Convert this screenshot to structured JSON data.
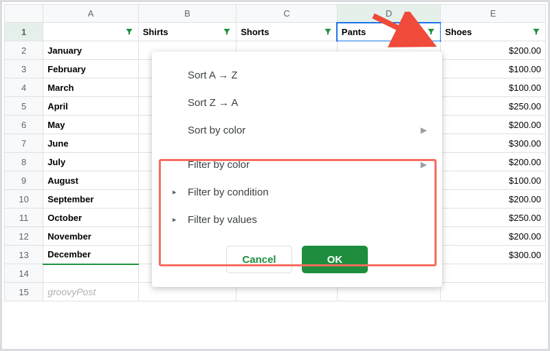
{
  "columns": {
    "A": "A",
    "B": "B",
    "C": "C",
    "D": "D",
    "E": "E"
  },
  "headers": {
    "B": "Shirts",
    "C": "Shorts",
    "D": "Pants",
    "E": "Shoes"
  },
  "months": [
    "January",
    "February",
    "March",
    "April",
    "May",
    "June",
    "July",
    "August",
    "September",
    "October",
    "November",
    "December"
  ],
  "values_E": [
    "$200.00",
    "$100.00",
    "$100.00",
    "$250.00",
    "$200.00",
    "$300.00",
    "$200.00",
    "$100.00",
    "$200.00",
    "$250.00",
    "$200.00",
    "$300.00"
  ],
  "dropdown": {
    "sort_az": "Sort A → Z",
    "sort_za": "Sort Z → A",
    "sort_color": "Sort by color",
    "filter_color": "Filter by color",
    "filter_condition": "Filter by condition",
    "filter_values": "Filter by values",
    "cancel": "Cancel",
    "ok": "OK"
  },
  "watermark": "groovyPost",
  "selected_column": "D"
}
